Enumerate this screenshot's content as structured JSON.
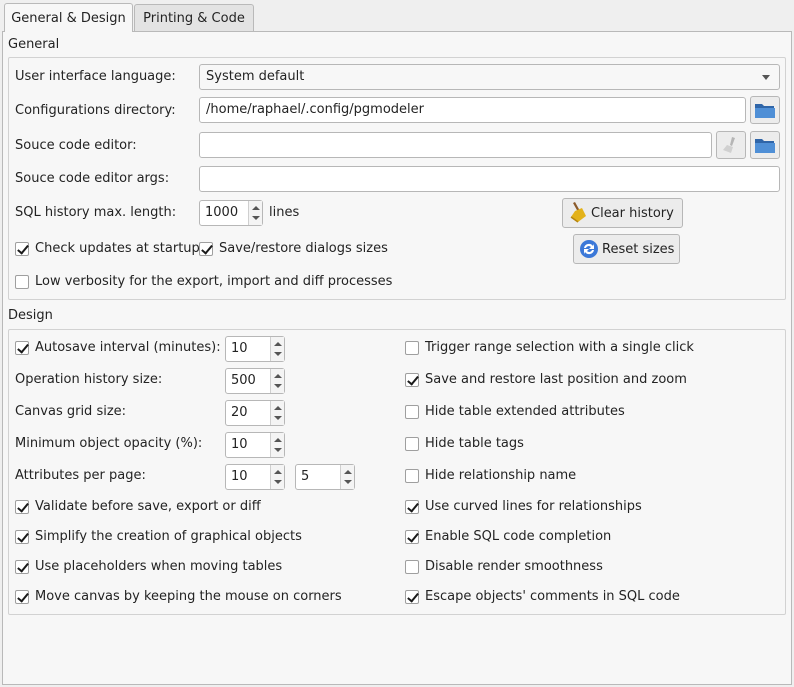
{
  "tabs": [
    {
      "label": "General & Design",
      "active": true
    },
    {
      "label": "Printing & Code",
      "active": false
    }
  ],
  "general": {
    "title": "General",
    "ui_language_label": "User interface language:",
    "ui_language_value": "System default",
    "config_dir_label": "Configurations directory:",
    "config_dir_value": "/home/raphael/.config/pgmodeler",
    "source_editor_label": "Souce code editor:",
    "source_editor_value": "",
    "source_editor_args_label": "Souce code editor args:",
    "source_editor_args_value": "",
    "sql_history_label": "SQL history max. length:",
    "sql_history_value": "1000",
    "sql_history_unit": "lines",
    "clear_history_label": "Clear history",
    "reset_sizes_label": "Reset sizes",
    "check_updates_label": "Check updates at startup",
    "check_updates_checked": true,
    "save_dialogs_label": "Save/restore dialogs sizes",
    "save_dialogs_checked": true,
    "low_verbosity_label": "Low verbosity for the export, import and diff processes",
    "low_verbosity_checked": false
  },
  "design": {
    "title": "Design",
    "autosave_label": "Autosave interval (minutes):",
    "autosave_checked": true,
    "autosave_value": "10",
    "op_history_label": "Operation history size:",
    "op_history_value": "500",
    "grid_size_label": "Canvas grid size:",
    "grid_size_value": "20",
    "min_opacity_label": "Minimum object opacity (%):",
    "min_opacity_value": "10",
    "attrs_per_page_label": "Attributes per page:",
    "attrs_per_page_value1": "10",
    "attrs_per_page_value2": "5",
    "left_checks": [
      {
        "label": "Validate before save, export or diff",
        "checked": true
      },
      {
        "label": "Simplify the creation of graphical objects",
        "checked": true
      },
      {
        "label": "Use placeholders when moving tables",
        "checked": true
      },
      {
        "label": "Move canvas by keeping the mouse on corners",
        "checked": true
      }
    ],
    "right_checks": [
      {
        "label": "Trigger range selection with a single click",
        "checked": false
      },
      {
        "label": "Save and restore last position and zoom",
        "checked": true
      },
      {
        "label": "Hide table extended attributes",
        "checked": false
      },
      {
        "label": "Hide table tags",
        "checked": false
      },
      {
        "label": "Hide relationship name",
        "checked": false
      },
      {
        "label": "Use curved lines for relationships",
        "checked": true
      },
      {
        "label": "Enable SQL code completion",
        "checked": true
      },
      {
        "label": "Disable render smoothness",
        "checked": false
      },
      {
        "label": "Escape objects' comments in SQL code",
        "checked": true
      }
    ]
  },
  "icons": {
    "folder": "folder-icon",
    "brush": "brush-icon",
    "reset": "refresh-icon"
  },
  "colors": {
    "folder_blue": "#3f7fc4",
    "reset_blue": "#2f6fd0"
  }
}
